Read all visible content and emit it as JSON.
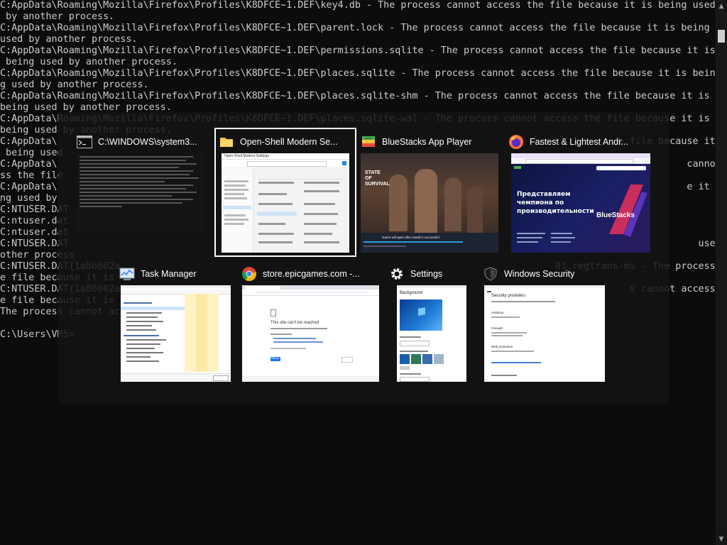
{
  "console": {
    "lines": [
      "C:AppData\\Roaming\\Mozilla\\Firefox\\Profiles\\K8DFCE~1.DEF\\key4.db - The process cannot access the file because it is being used",
      " by another process.",
      "C:AppData\\Roaming\\Mozilla\\Firefox\\Profiles\\K8DFCE~1.DEF\\parent.lock - The process cannot access the file because it is being",
      "used by another process.",
      "C:AppData\\Roaming\\Mozilla\\Firefox\\Profiles\\K8DFCE~1.DEF\\permissions.sqlite - The process cannot access the file because it is",
      " being used by another process.",
      "C:AppData\\Roaming\\Mozilla\\Firefox\\Profiles\\K8DFCE~1.DEF\\places.sqlite - The process cannot access the file because it is bein",
      "g used by another process.",
      "C:AppData\\Roaming\\Mozilla\\Firefox\\Profiles\\K8DFCE~1.DEF\\places.sqlite-shm - The process cannot access the file because it is",
      "being used by another process.",
      "C:AppData\\Roaming\\Mozilla\\Firefox\\Profiles\\K8DFCE~1.DEF\\places.sqlite-wal - The process cannot access the file because it is",
      "being used by another process.",
      "C:AppData\\                                                                                                  e file because it is",
      " being used                                                                                                                       ",
      "C:AppData\\                                                                                                              cannot acce",
      "ss the file                                                                                                                       ",
      "C:AppData\\                                                                                                              e it is bei",
      "ng used by                                                                                                                        ",
      "C:NTUSER.DAT                                                                                                                      ",
      "C:ntuser.dat                                                                                                                      ",
      "C:ntuser.dat                                                                                                                      ",
      "C:NTUSER.DAT                                                                                                              used by an",
      "other process                                                                                                                     ",
      "C:NTUSER.DAT{1a8b602a                                                                            01.regtrans-ms - The process cannot access th",
      "e file because it is                                                                                                              ",
      "C:NTUSER.DAT{1a8b602a                                                                                         s cannot access th",
      "e file because it is                                                                                                              ",
      "The process cannot ac                                                                                                             ",
      "",
      "C:\\Users\\VM5>"
    ]
  },
  "switcher": {
    "windows": [
      {
        "title": "C:\\WINDOWS\\system3...",
        "icon": "cmd-icon",
        "selected": false
      },
      {
        "title": "Open-Shell Modern Se...",
        "icon": "folder-icon",
        "selected": true
      },
      {
        "title": "BlueStacks App Player",
        "icon": "bluestacks-icon",
        "selected": false
      },
      {
        "title": "Fastest & Lightest Andr...",
        "icon": "firefox-icon",
        "selected": false
      },
      {
        "title": "Task Manager",
        "icon": "task-manager-icon",
        "selected": false
      },
      {
        "title": "store.epicgames.com -...",
        "icon": "chrome-icon",
        "selected": false
      },
      {
        "title": "Settings",
        "icon": "gear-icon",
        "selected": false
      },
      {
        "title": "Windows Security",
        "icon": "shield-icon",
        "selected": false
      }
    ],
    "thumbnails": {
      "explorer_title": "Open-Shell Modern Settings",
      "bs_game_title": "STATE OF SURVIVAL",
      "bs_caption": "Game will open after install is successful",
      "ff_headline": "Представляем чемпиона по производительности",
      "ff_brand": "BlueStacks",
      "chrome_message": "This site can't be reached",
      "chrome_button": "Reload",
      "settings_heading": "Background",
      "security_heading": "Security providers",
      "security_items": [
        "Antivirus",
        "Firewall",
        "Web protection"
      ]
    }
  },
  "colors": {
    "console_bg": "#0c0c0c",
    "console_text": "#cccccc",
    "switcher_bg": "#141414",
    "selection_border": "#ffffff"
  }
}
